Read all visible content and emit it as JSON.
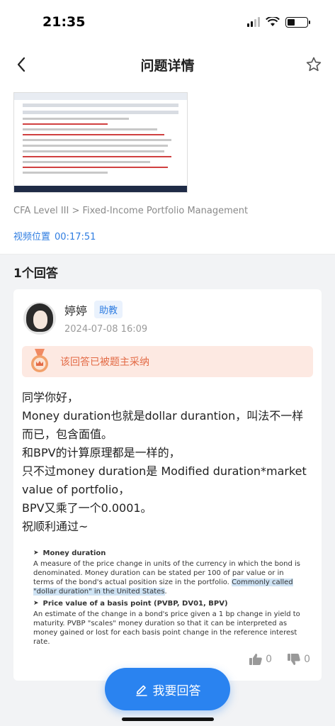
{
  "status_bar": {
    "time": "21:35"
  },
  "header": {
    "title": "问题详情"
  },
  "question": {
    "breadcrumb": "CFA Level III > Fixed-Income Portfolio Management",
    "video_label": "视频位置",
    "video_time": "00:17:51"
  },
  "answers": {
    "count_label": "1个回答",
    "items": [
      {
        "author": "婷婷",
        "role": "助教",
        "date": "2024-07-08 16:09",
        "adopted_label": "该回答已被题主采纳",
        "body": [
          "同学你好，",
          "Money duration也就是dollar durantion，叫法不一样而已，包含面值。",
          "和BPV的计算原理都是一样的，",
          "只不过money duration是 Modified duration*market value of portfolio，",
          "BPV又乘了一个0.0001。",
          "祝顺利通过~"
        ],
        "excerpt": {
          "h1": "Money duration",
          "p1_a": "A measure of the price change in units of the currency in which the bond is denominated. Money duration can be stated per 100 of par value or in terms of the bond's actual position size in the portfolio.",
          "p1_hl": "Commonly called \"dollar duration\" in the United States",
          "p1_end": ".",
          "h2": "Price value of a basis point (PVBP, DV01, BPV)",
          "p2": "An estimate of the change in a bond's price given a 1 bp change in yield to maturity. PVBP \"scales\" money duration so that it can be interpreted as money gained or lost for each basis point change in the reference interest rate."
        },
        "likes": "0",
        "dislikes": "0"
      }
    ]
  },
  "fab": {
    "label": "我要回答"
  },
  "icons": {
    "back": "chevron-left-icon",
    "favorite": "star-outline-icon",
    "medal": "medal-icon",
    "like": "thumbs-up-icon",
    "dislike": "thumbs-down-icon",
    "edit": "edit-icon"
  },
  "colors": {
    "accent": "#2a83f0",
    "link": "#2f7de1",
    "adopted_bg": "#fde9e2",
    "adopted_text": "#e36a45"
  }
}
